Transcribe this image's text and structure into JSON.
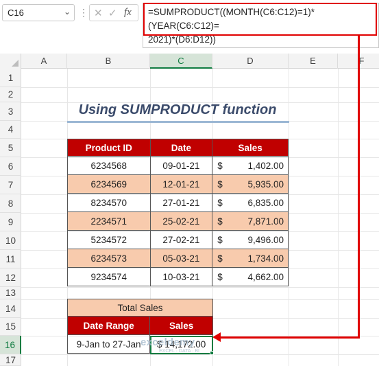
{
  "formula_bar": {
    "name_box": "C16",
    "cancel_glyph": "✕",
    "enter_glyph": "✓",
    "fx_label": "fx",
    "formula": "=SUMPRODUCT((MONTH(C6:C12)=1)*(YEAR(C6:C12)=\n2021)*(D6:D12))"
  },
  "columns": [
    "A",
    "B",
    "C",
    "D",
    "E",
    "F"
  ],
  "rows": [
    "1",
    "2",
    "3",
    "4",
    "5",
    "6",
    "7",
    "8",
    "9",
    "10",
    "11",
    "12",
    "13",
    "14",
    "15",
    "16",
    "17"
  ],
  "title": "Using SUMPRODUCT function",
  "table": {
    "headers": [
      "Product ID",
      "Date",
      "Sales"
    ],
    "rows": [
      {
        "id": "6234568",
        "date": "09-01-21",
        "cur": "$",
        "sales": "1,402.00"
      },
      {
        "id": "6234569",
        "date": "12-01-21",
        "cur": "$",
        "sales": "5,935.00"
      },
      {
        "id": "8234570",
        "date": "27-01-21",
        "cur": "$",
        "sales": "6,835.00"
      },
      {
        "id": "2234571",
        "date": "25-02-21",
        "cur": "$",
        "sales": "7,871.00"
      },
      {
        "id": "5234572",
        "date": "27-02-21",
        "cur": "$",
        "sales": "9,496.00"
      },
      {
        "id": "6234573",
        "date": "05-03-21",
        "cur": "$",
        "sales": "1,734.00"
      },
      {
        "id": "9234574",
        "date": "10-03-21",
        "cur": "$",
        "sales": "4,662.00"
      }
    ]
  },
  "summary": {
    "title": "Total Sales",
    "headers": [
      "Date Range",
      "Sales"
    ],
    "range": "9-Jan to 27-Jan",
    "total": "$ 14,172.00"
  },
  "watermark": {
    "name": "exceldemy",
    "sub": "EXCEL · DATA · BI"
  },
  "colors": {
    "header_red": "#c00000",
    "band_peach": "#f8cbad",
    "arrow_red": "#e00000",
    "title_blue": "#3b4b6b",
    "excel_green": "#107c41"
  }
}
